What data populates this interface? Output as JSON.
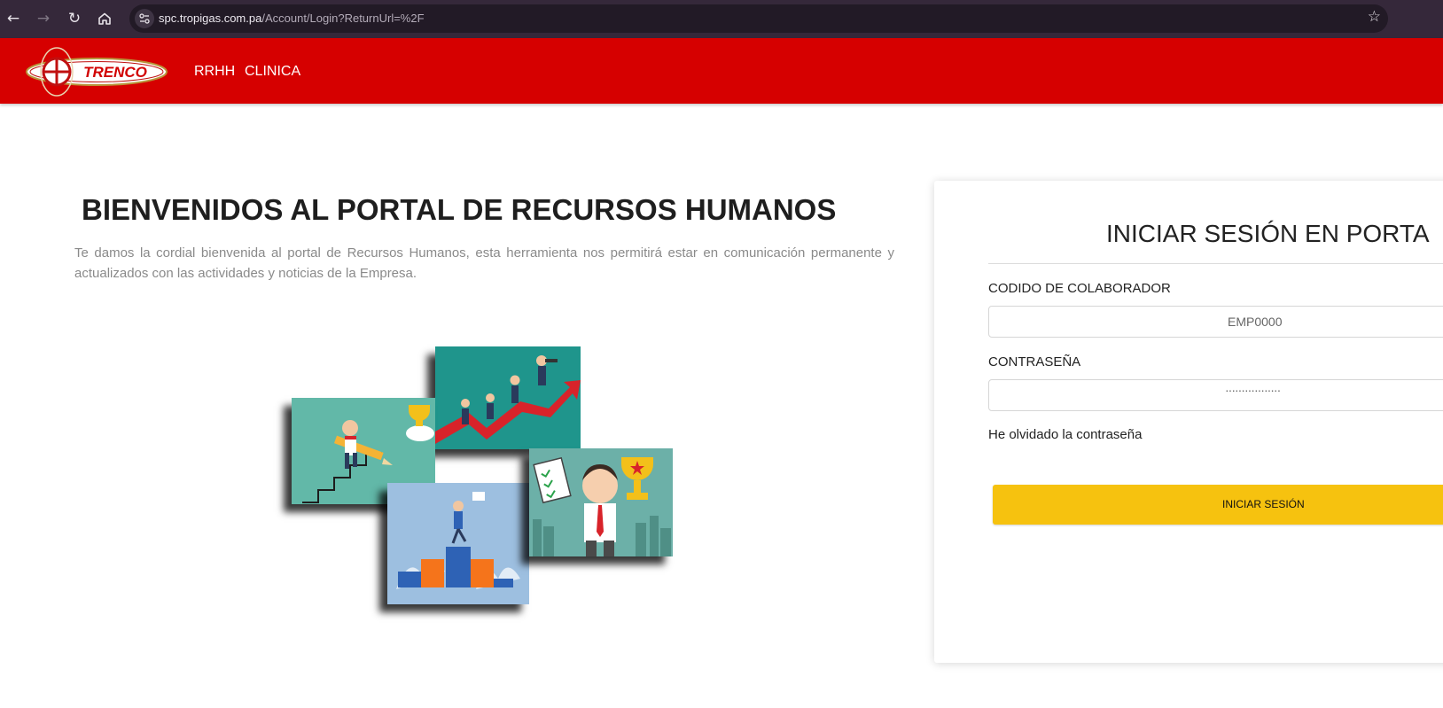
{
  "browser": {
    "url_domain": "spc.tropigas.com.pa",
    "url_path": "/Account/Login?ReturnUrl=%2F",
    "icons": [
      "back-icon",
      "forward-icon",
      "reload-icon",
      "home-icon",
      "site-info-icon",
      "bookmark-star-icon"
    ]
  },
  "header": {
    "logo_text": "TRENCO",
    "nav": [
      {
        "label": "RRHH"
      },
      {
        "label": "CLINICA"
      }
    ]
  },
  "hero": {
    "title": "BIENVENIDOS AL PORTAL DE RECURSOS HUMANOS",
    "description": "Te damos la cordial bienvenida al portal de Recursos Humanos, esta herramienta nos permitirá estar en comunicación permanente y actualizados con las actividades y noticias de la Empresa."
  },
  "login": {
    "title": "INICIAR SESIÓN EN PORTA",
    "code_label": "CODIDO DE COLABORADOR",
    "code_placeholder": "EMP0000",
    "password_label": "CONTRASEÑA",
    "password_value": "·················",
    "forgot_link": "He olvidado la contraseña",
    "submit_label": "INICIAR SESIÓN"
  },
  "colors": {
    "chrome": "#35283a",
    "navbar": "#d60000",
    "button": "#f6c20f"
  }
}
